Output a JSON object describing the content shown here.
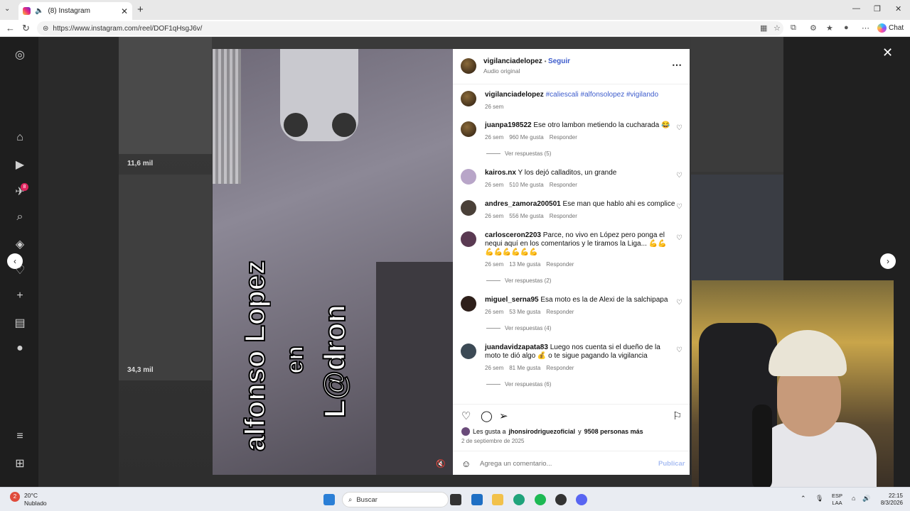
{
  "browser": {
    "tab_title": "(8) Instagram",
    "url": "https://www.instagram.com/reel/DOF1qHsgJ6v/",
    "chat_label": "Chat"
  },
  "grid": {
    "views_1": "11,6 mil",
    "views_2": "34,3 mil"
  },
  "sidebar": {
    "notification_count": "8"
  },
  "video": {
    "overlay_line1": "L@dron",
    "overlay_line2": "en",
    "overlay_line3": "alfonso Lopez"
  },
  "post": {
    "author": "vigilanciadelopez",
    "follow_label": "Seguir",
    "audio": "Audio original",
    "caption_user": "vigilanciadelopez",
    "caption_tags": "#caliescali #alfonsolopez #vigilando",
    "caption_age": "26 sem",
    "likes_prefix": "Les gusta a",
    "likes_user": "jhonsirodriguezoficial",
    "likes_and": "y",
    "likes_count": "9508 personas más",
    "date": "2 de septiembre de 2025",
    "add_comment_placeholder": "Agrega un comentario...",
    "publish_label": "Publicar"
  },
  "comments": [
    {
      "user": "juanpa198522",
      "text": "Ese otro lambon metiendo la cucharada 😂",
      "age": "26 sem",
      "likes": "960 Me gusta",
      "reply": "Responder",
      "replies": "Ver respuestas (5)"
    },
    {
      "user": "kairos.nx",
      "text": "Y los dejó calladitos, un grande",
      "age": "26 sem",
      "likes": "510 Me gusta",
      "reply": "Responder",
      "replies": ""
    },
    {
      "user": "andres_zamora200501",
      "text": "Ese man que hablo ahi es complice",
      "age": "26 sem",
      "likes": "556 Me gusta",
      "reply": "Responder",
      "replies": ""
    },
    {
      "user": "carlosceron2203",
      "text": "Parce, no vivo en López pero ponga el nequi aquí en los comentarios y le tiramos la Liga... 💪💪💪💪💪💪💪💪",
      "age": "26 sem",
      "likes": "13 Me gusta",
      "reply": "Responder",
      "replies": "Ver respuestas (2)"
    },
    {
      "user": "miguel_serna95",
      "text": "Esa moto es la de Alexi de la salchipapa",
      "age": "26 sem",
      "likes": "53 Me gusta",
      "reply": "Responder",
      "replies": "Ver respuestas (4)"
    },
    {
      "user": "juandavidzapata83",
      "text": "Luego nos cuenta si el dueño de la moto te dió algo 💰 o te sigue pagando la vigilancia",
      "age": "26 sem",
      "likes": "81 Me gusta",
      "reply": "Responder",
      "replies": "Ver respuestas (6)"
    }
  ],
  "taskbar": {
    "temperature": "20°C",
    "weather": "Nublado",
    "weather_badge": "2",
    "search_label": "Buscar",
    "lang_1": "ESP",
    "lang_2": "LAA",
    "time": "22:15",
    "date": "8/3/2026"
  },
  "icons": [
    "instagram-icon",
    "home-icon",
    "reels-icon",
    "messages-icon",
    "search-icon",
    "explore-icon",
    "notifications-icon",
    "create-icon",
    "dashboard-icon",
    "more-icon",
    "meta-icon",
    "heart-icon",
    "comment-icon",
    "share-icon",
    "bookmark-icon",
    "close-icon",
    "prev-arrow-icon",
    "next-arrow-icon",
    "emoji-icon"
  ]
}
